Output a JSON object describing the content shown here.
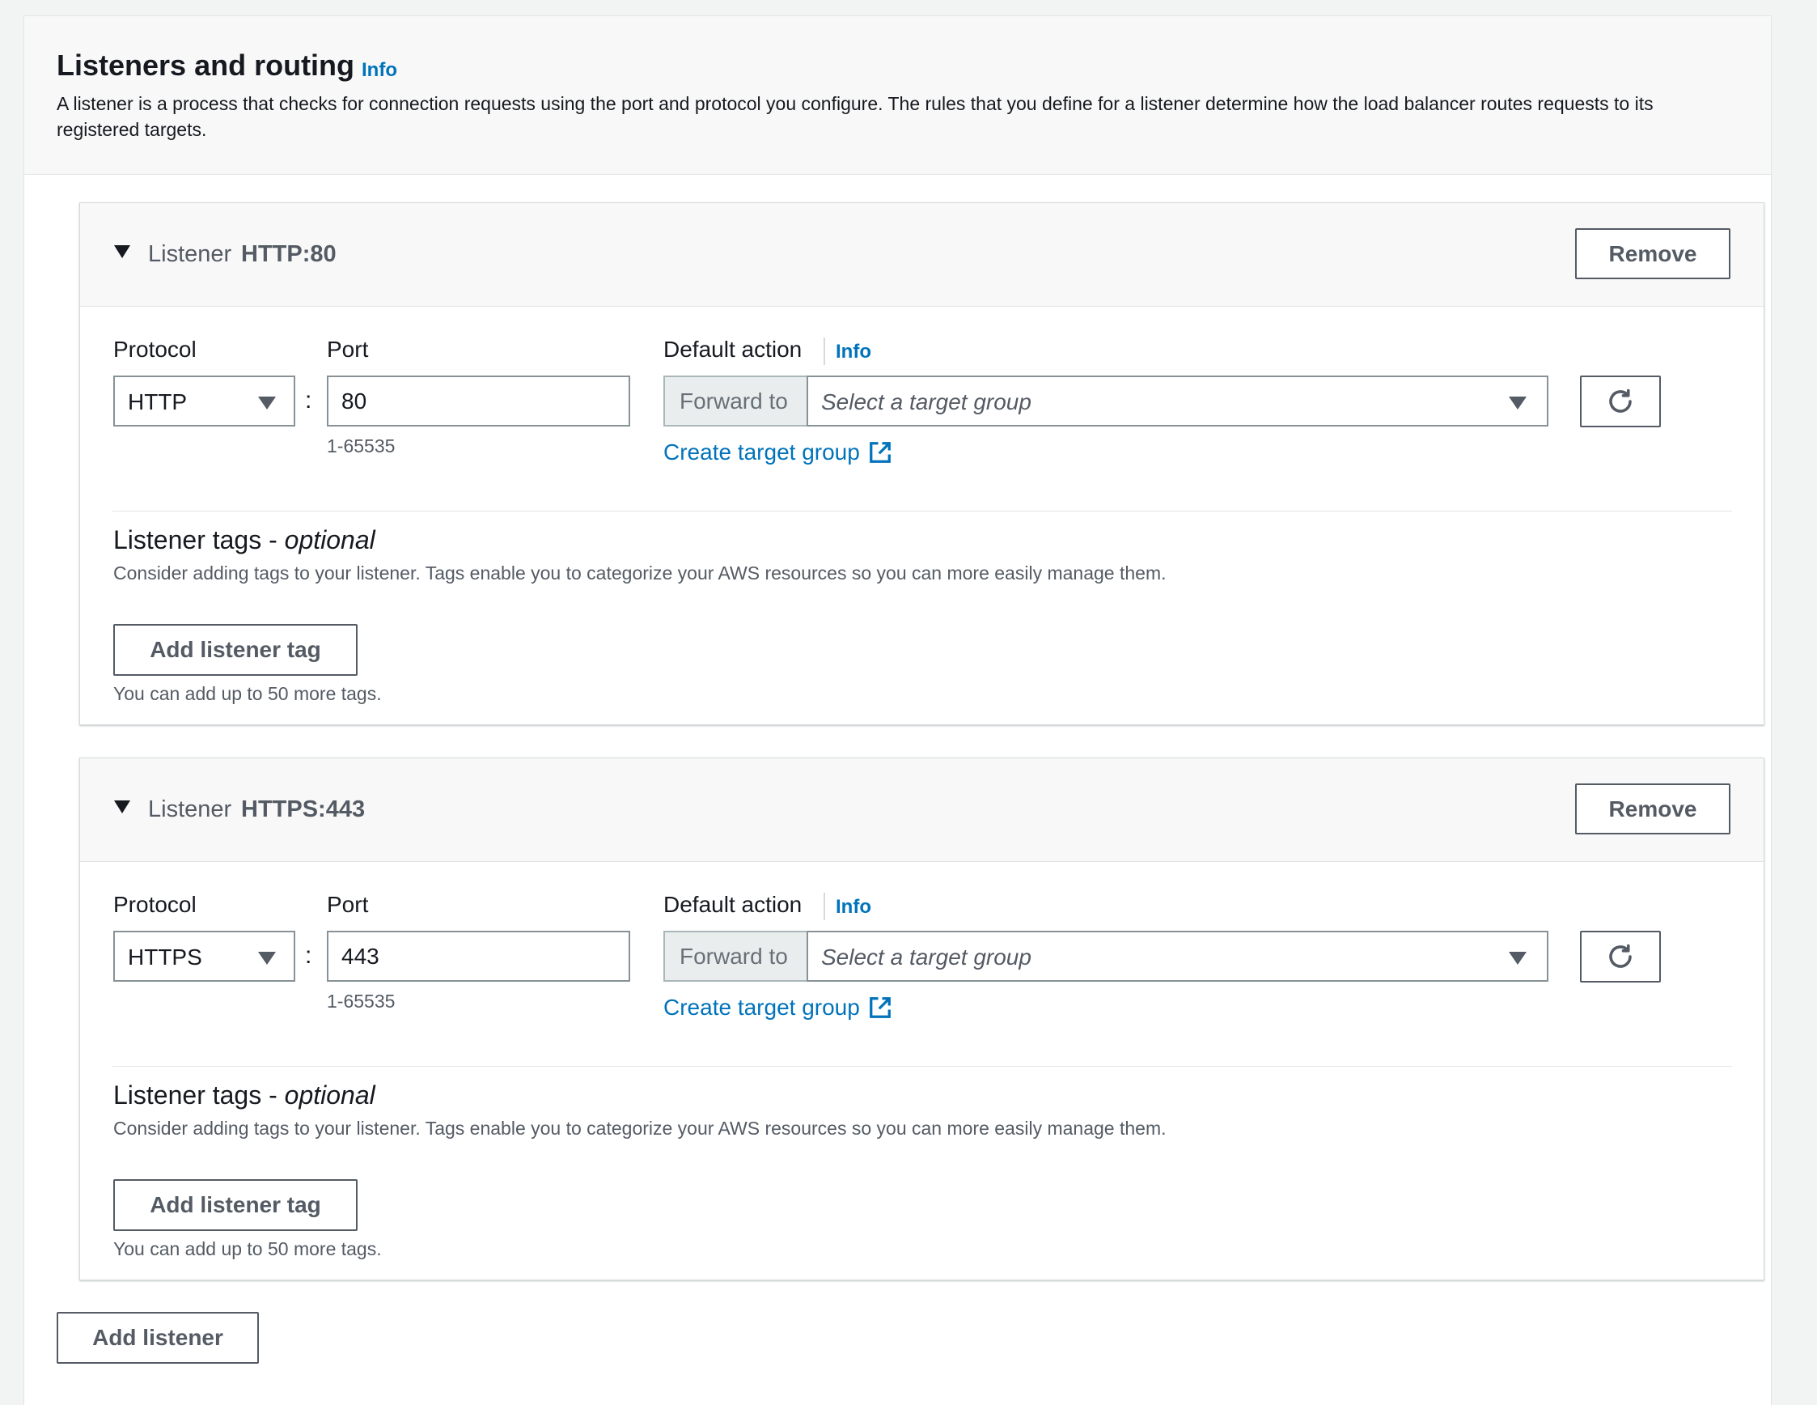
{
  "section": {
    "title": "Listeners and routing",
    "info_label": "Info",
    "description": "A listener is a process that checks for connection requests using the port and protocol you configure. The rules that you define for a listener determine how the load balancer routes requests to its registered targets."
  },
  "listeners": [
    {
      "label": "Listener",
      "id": "HTTP:80",
      "remove_label": "Remove",
      "protocol_label": "Protocol",
      "protocol_value": "HTTP",
      "port_label": "Port",
      "port_value": "80",
      "port_hint": "1-65535",
      "default_action_label": "Default action",
      "info_label": "Info",
      "forward_prefix": "Forward to",
      "target_placeholder": "Select a target group",
      "create_target_label": "Create target group",
      "tags_title": "Listener tags - ",
      "tags_title_optional": "optional",
      "tags_description": "Consider adding tags to your listener. Tags enable you to categorize your AWS resources so you can more easily manage them.",
      "add_tag_label": "Add listener tag",
      "tags_limit": "You can add up to 50 more tags."
    },
    {
      "label": "Listener",
      "id": "HTTPS:443",
      "remove_label": "Remove",
      "protocol_label": "Protocol",
      "protocol_value": "HTTPS",
      "port_label": "Port",
      "port_value": "443",
      "port_hint": "1-65535",
      "default_action_label": "Default action",
      "info_label": "Info",
      "forward_prefix": "Forward to",
      "target_placeholder": "Select a target group",
      "create_target_label": "Create target group",
      "tags_title": "Listener tags - ",
      "tags_title_optional": "optional",
      "tags_description": "Consider adding tags to your listener. Tags enable you to categorize your AWS resources so you can more easily manage them.",
      "add_tag_label": "Add listener tag",
      "tags_limit": "You can add up to 50 more tags."
    }
  ],
  "add_listener_label": "Add listener",
  "icons": {
    "expand": "caret-down-icon",
    "dropdown": "dropdown-caret-icon",
    "refresh": "refresh-icon",
    "external": "external-link-icon"
  },
  "colors": {
    "link": "#0073bb",
    "text": "#16191f",
    "secondary_text": "#545b64",
    "border": "#879196",
    "header_bg": "#f8f8f8",
    "page_bg": "#f2f3f3"
  }
}
